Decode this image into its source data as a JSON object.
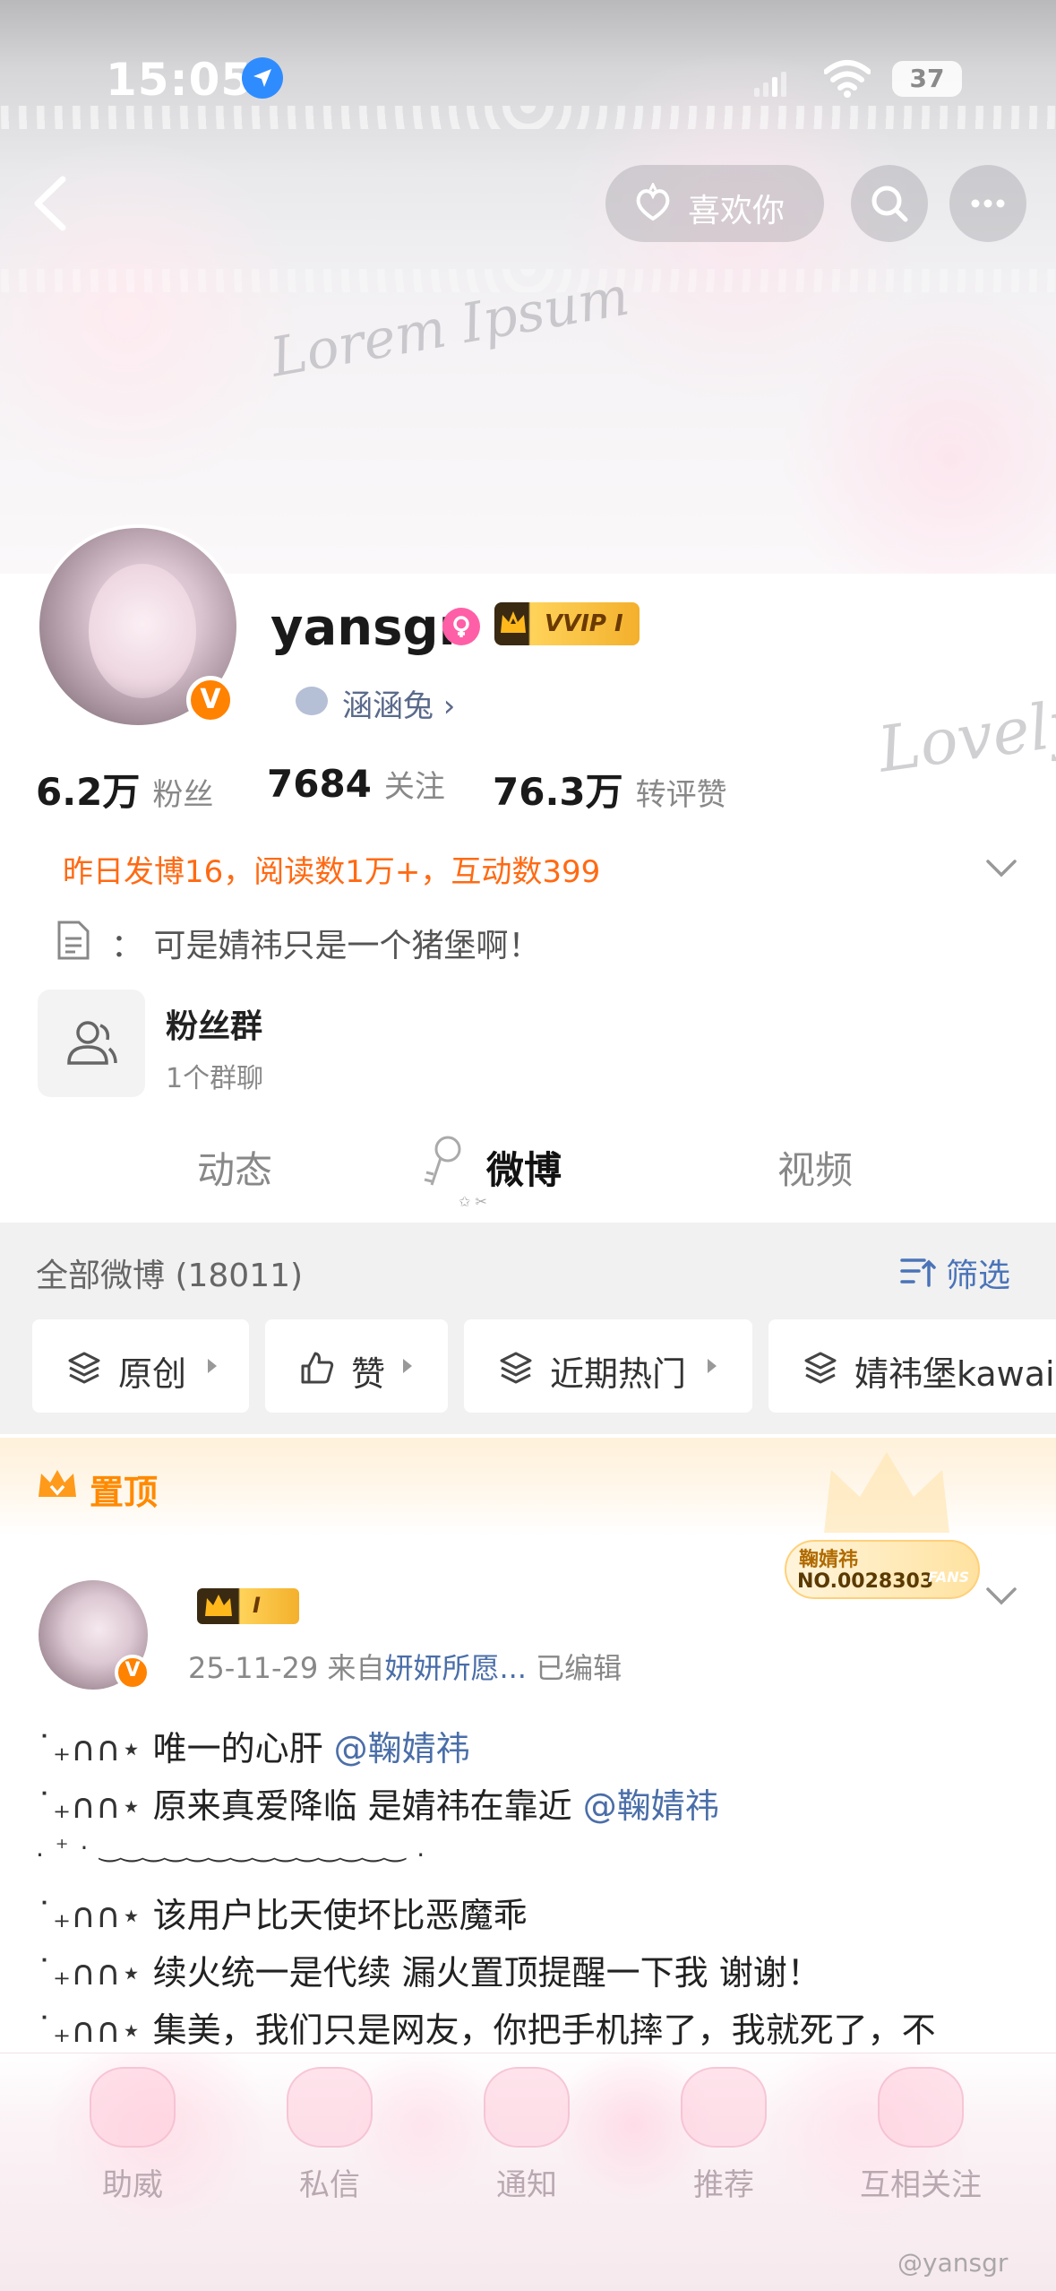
{
  "status_bar": {
    "time": "15:05",
    "battery": "37"
  },
  "header": {
    "like_label": "喜欢你"
  },
  "profile": {
    "username": "yansgr",
    "vip_badge": "VVIP I",
    "nickname_label": "涵涵兔 ›",
    "stats": [
      {
        "num": "6.2万",
        "label": "粉丝"
      },
      {
        "num": "7684",
        "label": "关注"
      },
      {
        "num": "76.3万",
        "label": "转评赞"
      }
    ],
    "yesterday": "昨日发博16，阅读数1万+，互动数399",
    "bio": "：  可是婧祎只是一个猪堡啊！",
    "fan_group": {
      "title": "粉丝群",
      "subtitle": "1个群聊"
    }
  },
  "tabs": [
    {
      "label": "动态",
      "active": false
    },
    {
      "label": "微博",
      "active": true
    },
    {
      "label": "视频",
      "active": false
    }
  ],
  "feed": {
    "all_label": "全部微博 (18011)",
    "filter_label": "筛选",
    "chips": [
      "原创",
      "赞",
      "近期热门",
      "婧祎堡kawai"
    ]
  },
  "pinned": {
    "label": "置顶",
    "badge": "I",
    "fans_card": {
      "name": "鞠婧祎",
      "number": "NO.0028303",
      "tag": "FANS"
    },
    "meta_date": "25-11-29  来自",
    "meta_source": "妍妍所愿...",
    "meta_edited": "  已编辑",
    "lines": [
      {
        "prefix": "˙₊∩∩⋆",
        "text": " 唯一的心肝 ",
        "mention": "@鞠婧祎"
      },
      {
        "prefix": "˙₊∩∩⋆",
        "text": " 原来真爱降临 是婧祎在靠近 ",
        "mention": "@鞠婧祎"
      },
      {
        "prefix": "˙₊∩∩⋆",
        "text": " 该用户比天使坏比恶魔乖",
        "mention": ""
      },
      {
        "prefix": "˙₊∩∩⋆",
        "text": " 续火统一是代续 漏火置顶提醒一下我 谢谢！",
        "mention": ""
      },
      {
        "prefix": "˙₊∩∩⋆",
        "text": " 集美，我们只是网友，你把手机摔了，我就死了，不",
        "mention": ""
      }
    ],
    "deco_line": ".  ⁺  ·    ‿‿‿‿‿‿‿‿‿‿‿‿‿‿     ."
  },
  "bottom_nav": [
    "助威",
    "私信",
    "通知",
    "推荐",
    "互相关注"
  ],
  "watermark": "@yansgr",
  "colors": {
    "accent_orange": "#ff8200",
    "link_blue": "#4a6ea8",
    "highlight_orange": "#ff6a13"
  }
}
